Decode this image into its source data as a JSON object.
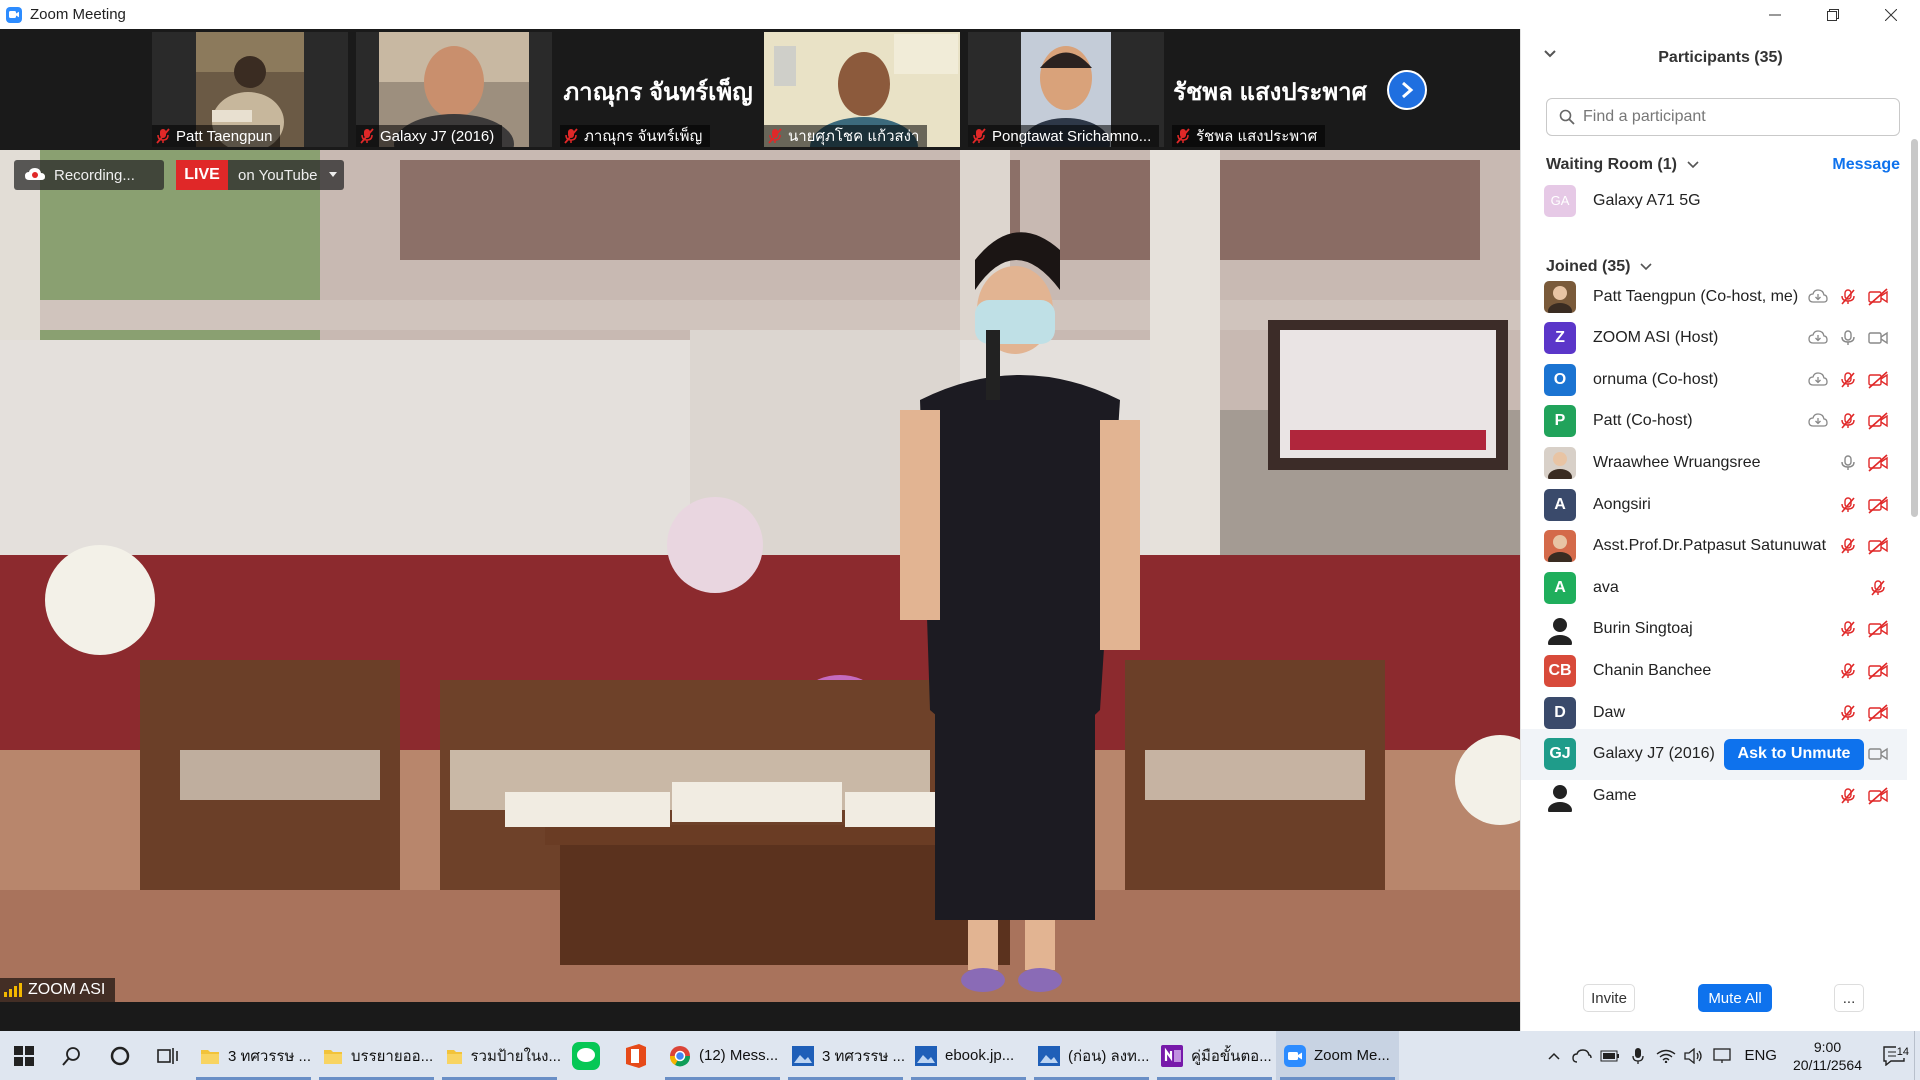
{
  "window": {
    "title": "Zoom Meeting"
  },
  "thumbnails": [
    {
      "name": "Patt Taengpun",
      "muted": true,
      "has_video": true
    },
    {
      "name": "Galaxy J7 (2016)",
      "muted": true,
      "has_video": true
    },
    {
      "name": "ภาณุกร จันทร์เพ็ญ",
      "muted": true,
      "has_video": false,
      "display_name": "ภาณุกร จันทร์เพ็ญ"
    },
    {
      "name": "นายศุภโชค แก้วสง่า",
      "muted": true,
      "has_video": true
    },
    {
      "name": "Pongtawat Srichamno...",
      "muted": true,
      "has_video": true
    },
    {
      "name": "รัชพล แสงประพาศ",
      "muted": true,
      "has_video": false,
      "display_name": "รัชพล  แสงประพาศ"
    }
  ],
  "main_video": {
    "recording_label": "Recording...",
    "live_label": "LIVE",
    "live_target": "on YouTube",
    "speaker_name": "ZOOM ASI"
  },
  "participants_panel": {
    "title": "Participants (35)",
    "search_placeholder": "Find a participant",
    "waiting_room_label": "Waiting Room (1)",
    "message_label": "Message",
    "waiting": [
      {
        "initials": "GA",
        "name": "Galaxy A71 5G",
        "color": "#e6c9e6"
      }
    ],
    "joined_label": "Joined (35)",
    "joined": [
      {
        "name": "Patt Taengpun (Co-host, me)",
        "avatar": "photo",
        "color": "#7a5a3a",
        "cloud": true,
        "mic": "muted",
        "cam": "off"
      },
      {
        "initials": "Z",
        "name": "ZOOM ASI (Host)",
        "color": "#5b36c9",
        "cloud": true,
        "mic": "on",
        "cam": "on"
      },
      {
        "initials": "O",
        "name": "ornuma (Co-host)",
        "color": "#1b74d2",
        "cloud": true,
        "mic": "muted",
        "cam": "off"
      },
      {
        "initials": "P",
        "name": "Patt (Co-host)",
        "color": "#21a35b",
        "cloud": true,
        "mic": "muted",
        "cam": "off"
      },
      {
        "name": "Wraawhee Wruangsree",
        "avatar": "photo",
        "color": "#d8d0c8",
        "cloud": false,
        "mic": "on",
        "cam": "off"
      },
      {
        "initials": "A",
        "name": "Aongsiri",
        "color": "#3a4a6b",
        "cloud": false,
        "mic": "muted",
        "cam": "off"
      },
      {
        "name": "Asst.Prof.Dr.Patpasut Satunuwat",
        "avatar": "photo",
        "color": "#d46a4a",
        "cloud": false,
        "mic": "muted",
        "cam": "off"
      },
      {
        "initials": "A",
        "name": "ava",
        "color": "#1fae5c",
        "cloud": false,
        "mic": "muted",
        "cam": "none"
      },
      {
        "name": "Burin Singtoaj",
        "avatar": "photo",
        "color": "#ffffff",
        "cloud": false,
        "mic": "muted",
        "cam": "off"
      },
      {
        "initials": "CB",
        "name": "Chanin Banchee",
        "color": "#d84a3a",
        "cloud": false,
        "mic": "muted",
        "cam": "off"
      },
      {
        "initials": "D",
        "name": "Daw",
        "color": "#3a4a6b",
        "cloud": false,
        "mic": "muted",
        "cam": "off"
      },
      {
        "initials": "GJ",
        "name": "Galaxy J7 (2016)",
        "color": "#1f9c8a",
        "cloud": false,
        "mic": "ask",
        "cam": "on"
      },
      {
        "name": "Game",
        "avatar": "photo",
        "color": "#ffffff",
        "cloud": false,
        "mic": "muted",
        "cam": "off"
      }
    ],
    "ask_unmute_label": "Ask to Unmute",
    "footer": {
      "invite": "Invite",
      "mute_all": "Mute All",
      "more": "..."
    }
  },
  "taskbar": {
    "apps": [
      {
        "label": "3 ทศวรรษ ...",
        "icon": "folder-icon",
        "underline": true
      },
      {
        "label": "บรรยายออ...",
        "icon": "folder-icon",
        "underline": true
      },
      {
        "label": "รวมป้ายในง...",
        "icon": "folder-icon",
        "underline": true
      },
      {
        "label": "(12) Mess...",
        "icon": "chrome-icon",
        "underline": true
      },
      {
        "label": "3 ทศวรรษ ...",
        "icon": "photos-icon",
        "underline": true
      },
      {
        "label": "ebook.jp...",
        "icon": "photos-icon",
        "underline": true
      },
      {
        "label": "(ก่อน) ลงท...",
        "icon": "photos-icon",
        "underline": true
      },
      {
        "label": "คู่มือขั้นตอ...",
        "icon": "onenote-icon",
        "underline": true
      },
      {
        "label": "Zoom Me...",
        "icon": "zoom-icon",
        "underline": true,
        "active": true
      }
    ],
    "language": "ENG",
    "time": "9:00",
    "date": "20/11/2564",
    "notification_count": "14"
  }
}
